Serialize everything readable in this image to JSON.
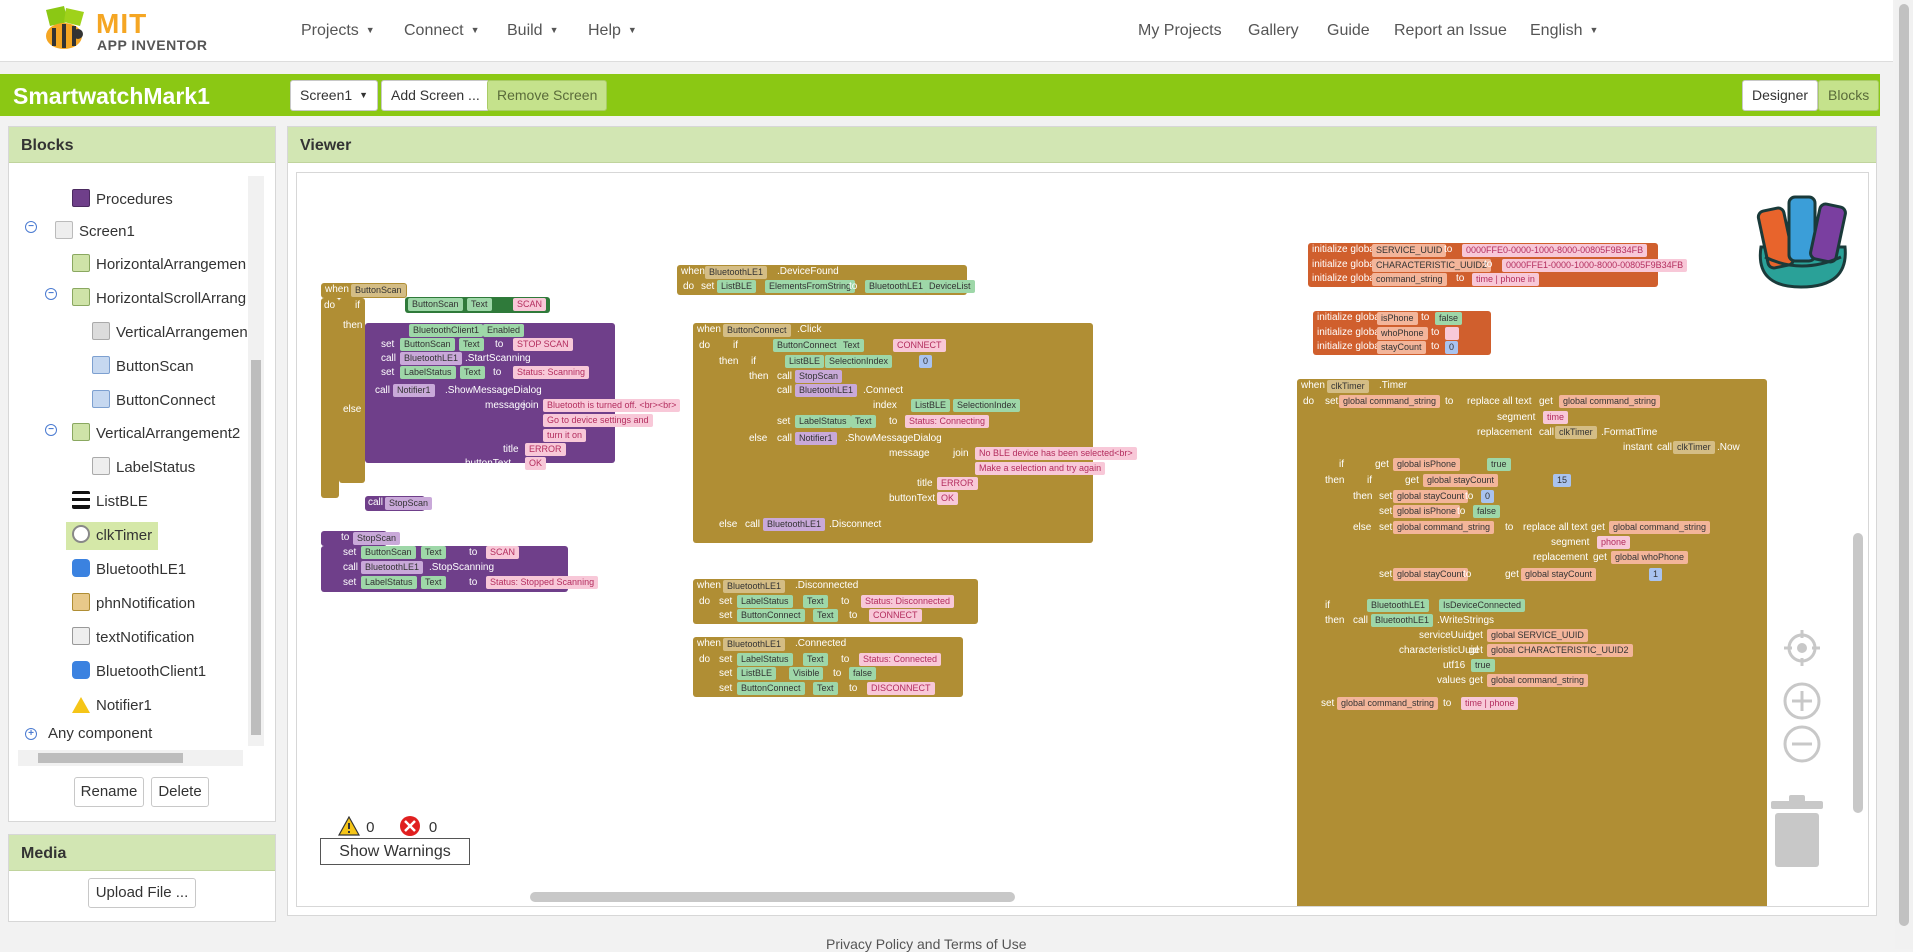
{
  "nav": {
    "logo_mit": "MIT",
    "logo_sub": "APP INVENTOR",
    "left": [
      "Projects",
      "Connect",
      "Build",
      "Help"
    ],
    "right": [
      "My Projects",
      "Gallery",
      "Guide",
      "Report an Issue",
      "English"
    ]
  },
  "project": {
    "title": "SmartwatchMark1",
    "screen_select": "Screen1",
    "add_screen": "Add Screen ...",
    "remove_screen": "Remove Screen",
    "designer": "Designer",
    "blocks": "Blocks"
  },
  "blocks_panel": {
    "title": "Blocks",
    "items": [
      "Procedures",
      "Screen1",
      "HorizontalArrangemen",
      "HorizontalScrollArrang",
      "VerticalArrangemen",
      "ButtonScan",
      "ButtonConnect",
      "VerticalArrangement2",
      "LabelStatus",
      "ListBLE",
      "clkTimer",
      "BluetoothLE1",
      "phnNotification",
      "textNotification",
      "BluetoothClient1",
      "Notifier1",
      "Any component"
    ],
    "selected": "clkTimer",
    "rename": "Rename",
    "delete": "Delete"
  },
  "media": {
    "title": "Media",
    "upload": "Upload File ..."
  },
  "viewer": {
    "title": "Viewer",
    "warnings_count": "0",
    "errors_count": "0",
    "show_warnings": "Show Warnings"
  },
  "blocks": {
    "b1": {
      "when": "when",
      "comp": "ButtonScan",
      "event": ".Click",
      "do": "do",
      "if": "if",
      "then": "then",
      "else": "else",
      "texts": [
        "ButtonScan",
        "Text",
        "SCAN",
        "BluetoothClient1",
        "Enabled",
        "set",
        "ButtonScan",
        "Text",
        "to",
        "STOP SCAN",
        "call",
        "BluetoothLE1",
        ".StartScanning",
        "set",
        "LabelStatus",
        "Text",
        "to",
        "Status: Scanning",
        "call",
        "Notifier1",
        ".ShowMessageDialog",
        "message",
        "join",
        "Bluetooth is turned off. <br><br>",
        "Go to device settings and",
        "turn it on",
        "title",
        "ERROR",
        "buttonText",
        "OK",
        "call",
        "StopScan"
      ]
    },
    "b2": {
      "to": "to",
      "name": "StopScan",
      "texts": [
        "set",
        "ButtonScan",
        "Text",
        "to",
        "SCAN",
        "call",
        "BluetoothLE1",
        ".StopScanning",
        "set",
        "LabelStatus",
        "Text",
        "to",
        "Status: Stopped Scanning"
      ]
    },
    "b3": {
      "texts": [
        "when",
        "BluetoothLE1",
        ".DeviceFound",
        "do",
        "set",
        "ListBLE",
        "ElementsFromString",
        "to",
        "BluetoothLE1",
        "DeviceList"
      ]
    },
    "b4": {
      "texts": [
        "when",
        "ButtonConnect",
        ".Click",
        "do",
        "if",
        "ButtonConnect",
        "Text",
        "CONNECT",
        "then",
        "if",
        "ListBLE",
        "SelectionIndex",
        "0",
        "then",
        "call",
        "StopScan",
        "call",
        "BluetoothLE1",
        ".Connect",
        "index",
        "ListBLE",
        "SelectionIndex",
        "set",
        "LabelStatus",
        "Text",
        "to",
        "Status: Connecting",
        "else",
        "call",
        "Notifier1",
        ".ShowMessageDialog",
        "message",
        "join",
        "No BLE device has been selected<br>",
        "Make a selection and try again",
        "title",
        "ERROR",
        "buttonText",
        "OK",
        "else",
        "call",
        "BluetoothLE1",
        ".Disconnect"
      ]
    },
    "b5": {
      "texts": [
        "when",
        "BluetoothLE1",
        ".Disconnected",
        "do",
        "set",
        "LabelStatus",
        "Text",
        "to",
        "Status: Disconnected",
        "set",
        "ButtonConnect",
        "Text",
        "to",
        "CONNECT"
      ]
    },
    "b6": {
      "texts": [
        "when",
        "BluetoothLE1",
        ".Connected",
        "do",
        "set",
        "LabelStatus",
        "Text",
        "to",
        "Status: Connected",
        "set",
        "ListBLE",
        "Visible",
        "to",
        "false",
        "set",
        "ButtonConnect",
        "Text",
        "to",
        "DISCONNECT"
      ]
    },
    "globals": [
      {
        "label": "initialize global",
        "name": "SERVICE_UUID",
        "to": "to",
        "value": "0000FFE0-0000-1000-8000-00805F9B34FB"
      },
      {
        "label": "initialize global",
        "name": "CHARACTERISTIC_UUID2",
        "to": "to",
        "value": "0000FFE1-0000-1000-8000-00805F9B34FB"
      },
      {
        "label": "initialize global",
        "name": "command_string",
        "to": "to",
        "value": "time | phone in"
      },
      {
        "label": "initialize global",
        "name": "isPhone",
        "to": "to",
        "value": "false"
      },
      {
        "label": "initialize global",
        "name": "whoPhone",
        "to": "to",
        "value": ""
      },
      {
        "label": "initialize global",
        "name": "stayCount",
        "to": "to",
        "value": "0"
      }
    ],
    "b7": {
      "texts": [
        "when",
        "clkTimer",
        ".Timer",
        "do",
        "set",
        "global command_string",
        "to",
        "replace all text",
        "get",
        "global command_string",
        "segment",
        "time",
        "replacement",
        "call",
        "clkTimer",
        ".FormatTime",
        "instant",
        "call",
        "clkTimer",
        ".Now",
        "if",
        "get",
        "global isPhone",
        "true",
        "then",
        "if",
        "get",
        "global stayCount",
        "15",
        "then",
        "set",
        "global stayCount",
        "to",
        "0",
        "set",
        "global isPhone",
        "to",
        "false",
        "else",
        "set",
        "global command_string",
        "to",
        "replace all text",
        "get",
        "global command_string",
        "segment",
        "phone",
        "replacement",
        "get",
        "global whoPhone",
        "set",
        "global stayCount",
        "to",
        "get",
        "global stayCount",
        "1",
        "if",
        "BluetoothLE1",
        "IsDeviceConnected",
        "then",
        "call",
        "BluetoothLE1",
        ".WriteStrings",
        "serviceUuid",
        "get",
        "global SERVICE_UUID",
        "characteristicUuid",
        "get",
        "global CHARACTERISTIC_UUID2",
        "utf16",
        "true",
        "values",
        "get",
        "global command_string",
        "set",
        "global command_string",
        "to",
        "time | phone"
      ]
    }
  },
  "footer": "Privacy Policy and Terms of Use",
  "colors": {
    "green": "#8bc814",
    "control": "#b08e34",
    "component": "#2f7a3a",
    "text": "#b32d5e",
    "proc": "#6f3f8a",
    "var": "#d05f2d",
    "math": "#3f6fbf"
  }
}
